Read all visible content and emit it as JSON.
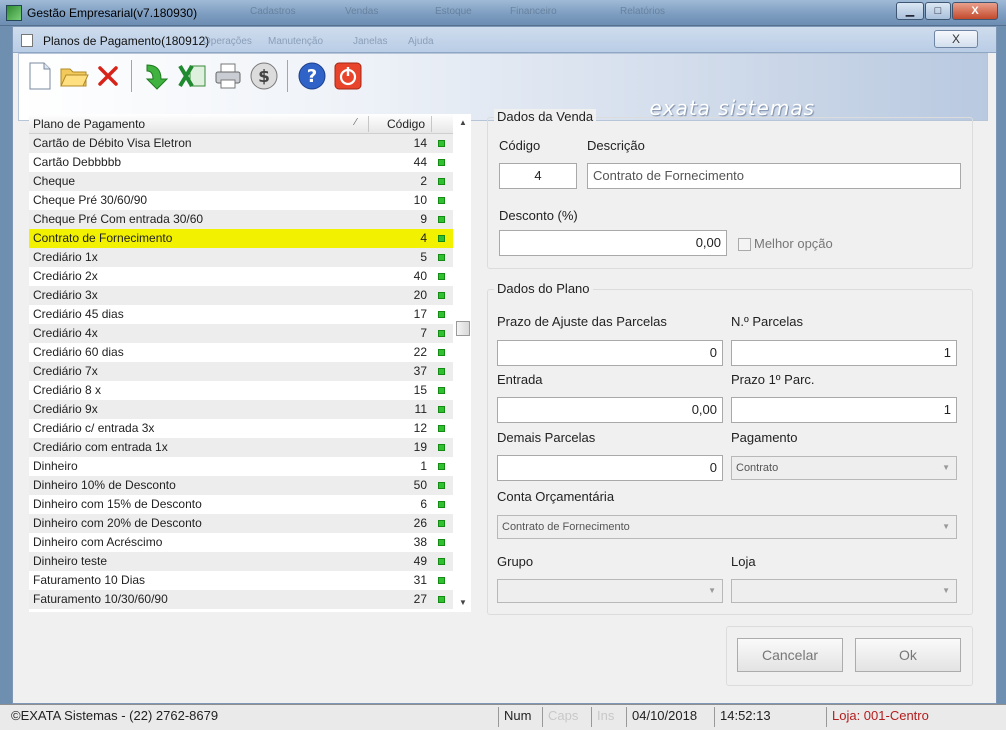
{
  "outer_window": {
    "title": "Gestão Empresarial(v7.180930)",
    "ghost_menu": [
      "Cadastros",
      "Vendas",
      "Estoque",
      "Financeiro",
      "Relatórios"
    ],
    "buttons": {
      "minimize": "▁",
      "maximize": "□",
      "close": "X"
    }
  },
  "inner_window": {
    "title": "Planos de Pagamento(180912)",
    "ghost_menu": [
      "Operações",
      "Manutenção",
      "Janelas",
      "Ajuda"
    ],
    "close_label": "X"
  },
  "toolbar": {
    "buttons": [
      "new-document",
      "open-folder",
      "delete",
      "import-green-arrow",
      "export-excel",
      "print",
      "money",
      "help",
      "exit-power"
    ],
    "brand": "exata sistemas"
  },
  "list": {
    "header_name": "Plano de Pagamento",
    "header_sort_glyph": "⁄",
    "header_code": "Código",
    "rows": [
      {
        "name": "Cartão de Débito Visa Eletron",
        "code": "14"
      },
      {
        "name": "Cartão Debbbbb",
        "code": "44"
      },
      {
        "name": "Cheque",
        "code": "2"
      },
      {
        "name": "Cheque Pré 30/60/90",
        "code": "10"
      },
      {
        "name": "Cheque Pré Com entrada 30/60",
        "code": "9"
      },
      {
        "name": "Contrato de Fornecimento",
        "code": "4"
      },
      {
        "name": "Crediário 1x",
        "code": "5"
      },
      {
        "name": "Crediário 2x",
        "code": "40"
      },
      {
        "name": "Crediário 3x",
        "code": "20"
      },
      {
        "name": "Crediário 45 dias",
        "code": "17"
      },
      {
        "name": "Crediário 4x",
        "code": "7"
      },
      {
        "name": "Crediário 60 dias",
        "code": "22"
      },
      {
        "name": "Crediário 7x",
        "code": "37"
      },
      {
        "name": "Crediário 8 x",
        "code": "15"
      },
      {
        "name": "Crediário 9x",
        "code": "11"
      },
      {
        "name": "Crediário c/ entrada 3x",
        "code": "12"
      },
      {
        "name": "Crediário com entrada 1x",
        "code": "19"
      },
      {
        "name": "Dinheiro",
        "code": "1"
      },
      {
        "name": "Dinheiro 10% de Desconto",
        "code": "50"
      },
      {
        "name": "Dinheiro com 15% de Desconto",
        "code": "6"
      },
      {
        "name": "Dinheiro com 20% de Desconto",
        "code": "26"
      },
      {
        "name": "Dinheiro com Acréscimo",
        "code": "38"
      },
      {
        "name": "Dinheiro teste",
        "code": "49"
      },
      {
        "name": "Faturamento 10 Dias",
        "code": "31"
      },
      {
        "name": "Faturamento 10/30/60/90",
        "code": "27"
      }
    ],
    "selected_index": 5,
    "scroll_up": "▲",
    "scroll_down": "▼"
  },
  "venda": {
    "title": "Dados da Venda",
    "codigo_label": "Código",
    "codigo_value": "4",
    "descricao_label": "Descrição",
    "descricao_value": "Contrato de Fornecimento",
    "desconto_label": "Desconto (%)",
    "desconto_value": "0,00",
    "melhor_opcao_label": "Melhor opção"
  },
  "plano": {
    "title": "Dados do Plano",
    "prazo_label": "Prazo de Ajuste das Parcelas",
    "prazo_value": "0",
    "nparcelas_label": "N.º Parcelas",
    "nparcelas_value": "1",
    "entrada_label": "Entrada",
    "entrada_value": "0,00",
    "prazo1_label": "Prazo 1º Parc.",
    "prazo1_value": "1",
    "demais_label": "Demais Parcelas",
    "demais_value": "0",
    "pagamento_label": "Pagamento",
    "pagamento_value": "Contrato",
    "conta_label": "Conta Orçamentária",
    "conta_value": "Contrato de Fornecimento",
    "grupo_label": "Grupo",
    "grupo_value": "",
    "loja_label": "Loja",
    "loja_value": "",
    "caret": "▼"
  },
  "actions": {
    "cancelar": "Cancelar",
    "ok": "Ok"
  },
  "status": {
    "copyright": "©EXATA Sistemas - (22) 2762-8679",
    "num": "Num",
    "caps": "Caps",
    "ins": "Ins",
    "date": "04/10/2018",
    "time": "14:52:13",
    "loja": "Loja: 001-Centro"
  }
}
